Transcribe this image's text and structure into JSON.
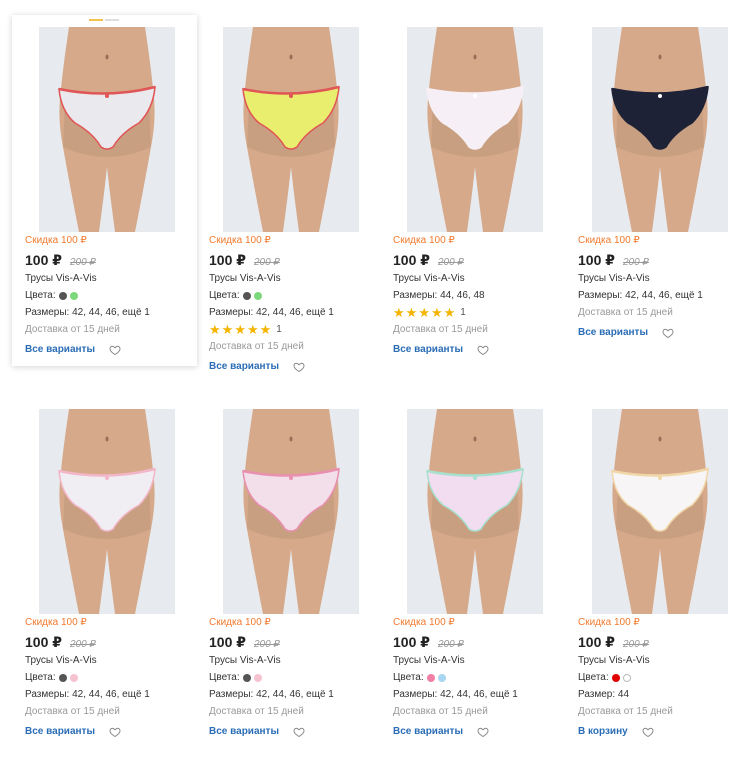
{
  "products": [
    {
      "discount": "Скидка 100 ₽",
      "price": "100 ₽",
      "old_price": "200 ₽",
      "title": "Трусы Vis-A-Vis",
      "colors_label": "Цвета:",
      "colors": [
        "#555555",
        "#7bd97b"
      ],
      "sizes": "Размеры: 42, 44, 46, ещё 1",
      "rating": null,
      "rating_count": "",
      "delivery": "Доставка от 15 дней",
      "action": "Все варианты",
      "fabric": "#e9e9ee",
      "waist": "#e05555",
      "hovered": true
    },
    {
      "discount": "Скидка 100 ₽",
      "price": "100 ₽",
      "old_price": "200 ₽",
      "title": "Трусы Vis-A-Vis",
      "colors_label": "Цвета:",
      "colors": [
        "#555555",
        "#7bd97b"
      ],
      "sizes": "Размеры: 42, 44, 46, ещё 1",
      "rating": 5,
      "rating_count": "1",
      "delivery": "Доставка от 15 дней",
      "action": "Все варианты",
      "fabric": "#eaee6e",
      "waist": "#e05555",
      "hovered": false
    },
    {
      "discount": "Скидка 100 ₽",
      "price": "100 ₽",
      "old_price": "200 ₽",
      "title": "Трусы Vis-A-Vis",
      "colors_label": "",
      "colors": [],
      "sizes": "Размеры: 44, 46, 48",
      "rating": 5,
      "rating_count": "1",
      "delivery": "Доставка от 15 дней",
      "action": "Все варианты",
      "fabric": "#f6f0f6",
      "waist": "#f6f0f6",
      "hovered": false
    },
    {
      "discount": "Скидка 100 ₽",
      "price": "100 ₽",
      "old_price": "200 ₽",
      "title": "Трусы Vis-A-Vis",
      "colors_label": "",
      "colors": [],
      "sizes": "Размеры: 42, 44, 46, ещё 1",
      "rating": null,
      "rating_count": "",
      "delivery": "Доставка от 15 дней",
      "action": "Все варианты",
      "fabric": "#1e2236",
      "waist": "#1e2236",
      "hovered": false
    },
    {
      "discount": "Скидка 100 ₽",
      "price": "100 ₽",
      "old_price": "200 ₽",
      "title": "Трусы Vis-A-Vis",
      "colors_label": "Цвета:",
      "colors": [
        "#555555",
        "#f5c2cf"
      ],
      "sizes": "Размеры: 42, 44, 46, ещё 1",
      "rating": null,
      "rating_count": "",
      "delivery": "Доставка от 15 дней",
      "action": "Все варианты",
      "fabric": "#f1eef3",
      "waist": "#f2b6c8",
      "hovered": false
    },
    {
      "discount": "Скидка 100 ₽",
      "price": "100 ₽",
      "old_price": "200 ₽",
      "title": "Трусы Vis-A-Vis",
      "colors_label": "Цвета:",
      "colors": [
        "#555555",
        "#f5c2cf"
      ],
      "sizes": "Размеры: 42, 44, 46, ещё 1",
      "rating": null,
      "rating_count": "",
      "delivery": "Доставка от 15 дней",
      "action": "Все варианты",
      "fabric": "#f3dfe9",
      "waist": "#e98fb0",
      "hovered": false
    },
    {
      "discount": "Скидка 100 ₽",
      "price": "100 ₽",
      "old_price": "200 ₽",
      "title": "Трусы Vis-A-Vis",
      "colors_label": "Цвета:",
      "colors": [
        "#f07fa6",
        "#a9d6f0"
      ],
      "sizes": "Размеры: 42, 44, 46, ещё 1",
      "rating": null,
      "rating_count": "",
      "delivery": "Доставка от 15 дней",
      "action": "Все варианты",
      "fabric": "#f2dcef",
      "waist": "#a7e0cf",
      "hovered": false
    },
    {
      "discount": "Скидка 100 ₽",
      "price": "100 ₽",
      "old_price": "200 ₽",
      "title": "Трусы Vis-A-Vis",
      "colors_label": "Цвета:",
      "colors": [
        "#e00000",
        "#ffffff"
      ],
      "sizes": "Размер: 44",
      "rating": null,
      "rating_count": "",
      "delivery": "Доставка от 15 дней",
      "action": "В корзину",
      "fabric": "#f7f5f6",
      "waist": "#f1d7a8",
      "hovered": false
    }
  ],
  "colors": {
    "accent_orange": "#f2792c",
    "link_blue": "#2a6db6",
    "star": "#f5b400",
    "skin": "#d6a98b",
    "photo_bg": "#e7ebef"
  }
}
